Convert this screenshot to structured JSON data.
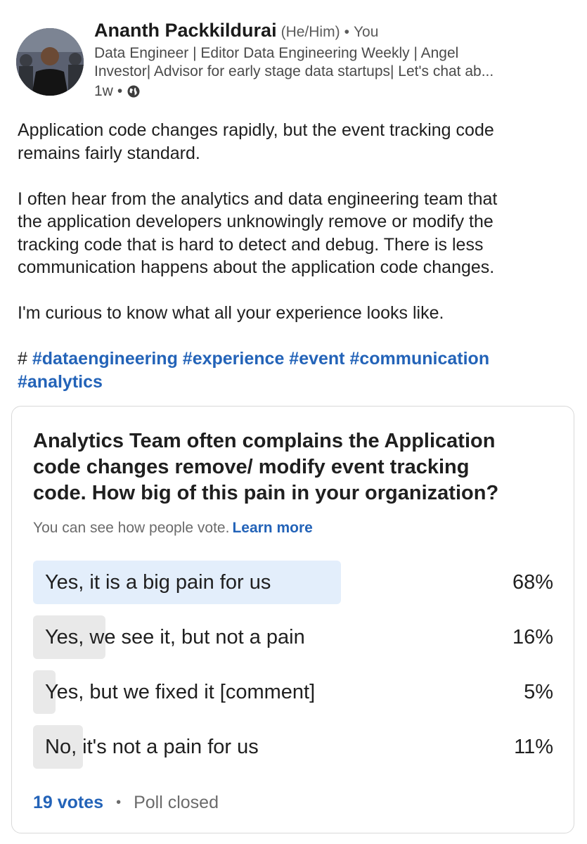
{
  "author": {
    "name": "Ananth Packkildurai",
    "pronouns": "(He/Him)",
    "connection": "You",
    "headline_lines": [
      "Data Engineer | Editor Data Engineering Weekly | Angel",
      "Investor| Advisor for early stage data startups| Let's chat ab..."
    ],
    "time": "1w",
    "visibility_icon": "globe-icon"
  },
  "post": {
    "paragraphs": [
      [
        "Application code changes rapidly, but the event tracking code",
        "remains fairly standard."
      ],
      [
        "I often hear from the analytics and data engineering team that",
        "the application developers unknowingly remove or modify the",
        "tracking code that is hard to detect and debug. There is less",
        "communication happens about the application code changes."
      ],
      [
        "I'm curious to know what all your experience looks like."
      ]
    ],
    "hash_prefix": "#",
    "hashtags_line1": "#dataengineering #experience #event #communication",
    "hashtags_line2": "#analytics"
  },
  "poll": {
    "question_lines": [
      "Analytics Team often complains the Application",
      "code changes remove/ modify event tracking",
      "code. How big of this pain in your organization?"
    ],
    "note": "You can see how people vote.",
    "learn_more": "Learn more",
    "options": [
      {
        "label": "Yes, it is a big pain for us",
        "percent_text": "68%",
        "percent": 68
      },
      {
        "label": "Yes, we see it, but not a pain",
        "percent_text": "16%",
        "percent": 16
      },
      {
        "label": "Yes, but we fixed it [comment]",
        "percent_text": "5%",
        "percent": 5
      },
      {
        "label": "No, it's not a pain for us",
        "percent_text": "11%",
        "percent": 11
      }
    ],
    "votes": "19 votes",
    "separator": "•",
    "status": "Poll closed",
    "colors": {
      "winning_bar": "#e3eefb",
      "other_bar": "#e9e9e9",
      "link": "#2363b8"
    }
  }
}
